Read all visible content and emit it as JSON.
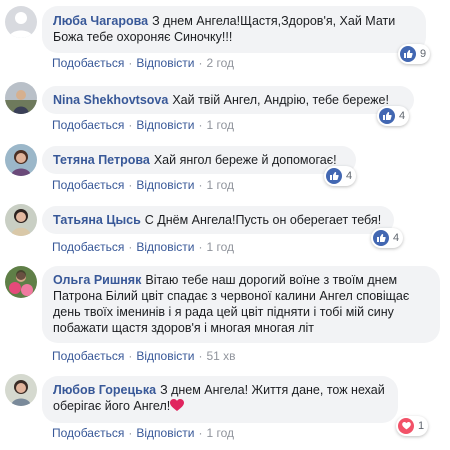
{
  "comments": [
    {
      "author": "Люба Чагарова",
      "text": "З днем Ангела!Щастя,Здоров'я, Хай Мати Божа тебе охороняє Синочку!!!",
      "like_label": "Подобається",
      "reply_label": "Відповісти",
      "time": "2 год",
      "reaction_count": "9",
      "reaction_icon": "like-icon",
      "avatar": "default-profile-silhouette"
    },
    {
      "author": "Nina Shekhovtsova",
      "text": "Хай твій Ангел, Андрію, тебе береже!",
      "like_label": "Подобається",
      "reply_label": "Відповісти",
      "time": "1 год",
      "reaction_count": "4",
      "reaction_icon": "like-icon",
      "avatar": "user-photo"
    },
    {
      "author": "Тетяна Петрова",
      "text": "Хай янгол береже й допомогає!",
      "like_label": "Подобається",
      "reply_label": "Відповісти",
      "time": "1 год",
      "reaction_count": "4",
      "reaction_icon": "like-icon",
      "avatar": "user-photo"
    },
    {
      "author": "Татьяна Цысь",
      "text": "С Днём Ангела!Пусть он оберегает тебя!",
      "like_label": "Подобається",
      "reply_label": "Відповісти",
      "time": "1 год",
      "reaction_count": "4",
      "reaction_icon": "like-icon",
      "avatar": "user-photo"
    },
    {
      "author": "Ольга Ришняк",
      "text": "Вітаю тебе наш дорогий воїне з твоїм днем Патрона Білий цвіт спадає з червоної калини Ангел сповіщає день твоїх іменинів і я рада цей цвіт підняти і тобі мій сину побажати щастя здоров'я і многая многая літ",
      "like_label": "Подобається",
      "reply_label": "Відповісти",
      "time": "51 хв",
      "avatar": "user-photo"
    },
    {
      "author": "Любов Горецька",
      "text": "З днем Ангела! Життя дане, тож нехай оберігає його Ангел!",
      "like_label": "Подобається",
      "reply_label": "Відповісти",
      "time": "1 год",
      "reaction_count": "1",
      "reaction_icon": "love-icon",
      "avatar": "user-photo"
    }
  ],
  "colors": {
    "bubble": "#f2f3f5",
    "author": "#385898",
    "like": "#4267b2",
    "love": "#f25268",
    "meta": "#90949c"
  }
}
